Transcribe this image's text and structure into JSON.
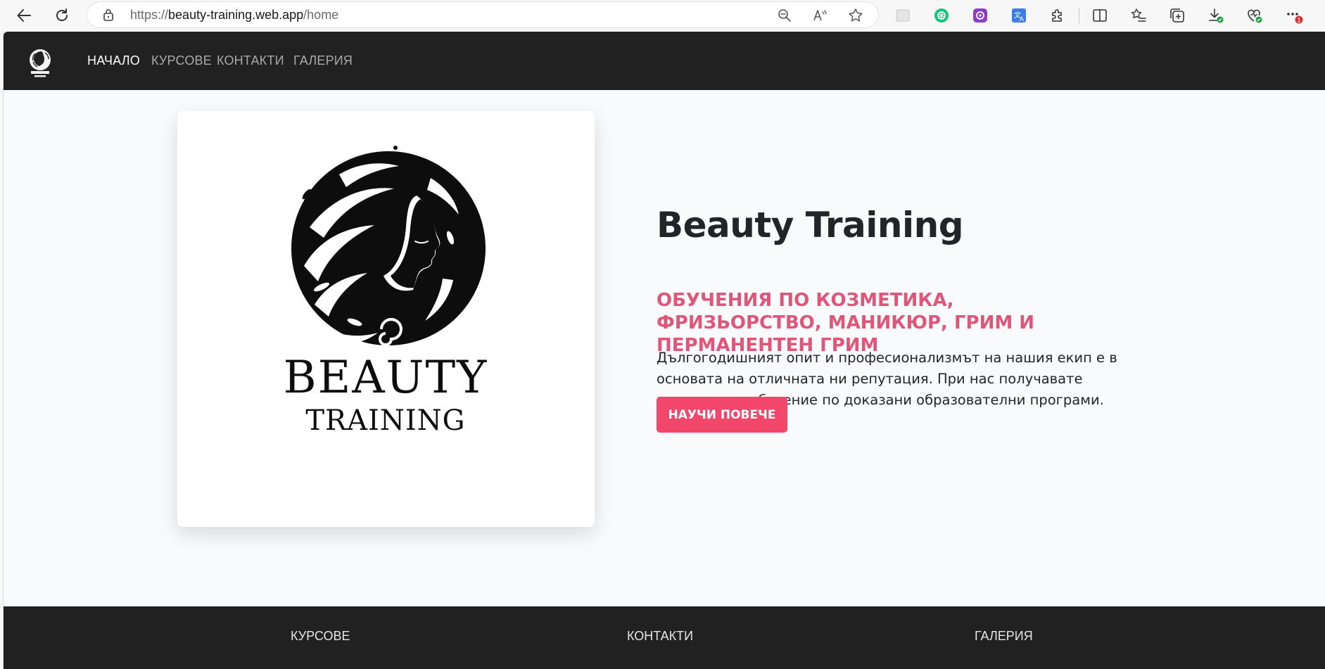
{
  "browser": {
    "url_scheme": "https://",
    "url_host": "beauty-training.web.app",
    "url_path": "/home",
    "notification_badge": "1"
  },
  "nav": {
    "items": [
      {
        "label": "НАЧАЛО",
        "active": true
      },
      {
        "label": "КУРСОВЕ",
        "active": false
      },
      {
        "label": "КОНТАКТИ",
        "active": false
      },
      {
        "label": "ГАЛЕРИЯ",
        "active": false
      }
    ]
  },
  "logo": {
    "line1": "BEAUTY",
    "line2": "TRAINING"
  },
  "hero": {
    "title": "Beauty Training",
    "subtitle": "ОБУЧЕНИЯ ПО КОЗМЕТИКА, ФРИЗЬОРСТВО, МАНИКЮР, ГРИМ И ПЕРМАНЕНТЕН ГРИМ",
    "text": "Дългогодишният опит и професионализмът на нашия екип е в основата на отличната ни репутация. При нас получавате пълноценно обучение по доказани образователни програми.",
    "cta_label": "НАУЧИ ПОВЕЧЕ"
  },
  "footer": {
    "links": [
      "КУРСОВЕ",
      "КОНТАКТИ",
      "ГАЛЕРИЯ"
    ]
  },
  "colors": {
    "accent": "#f2466a",
    "subtitle": "#e0567a",
    "dark": "#222121"
  }
}
